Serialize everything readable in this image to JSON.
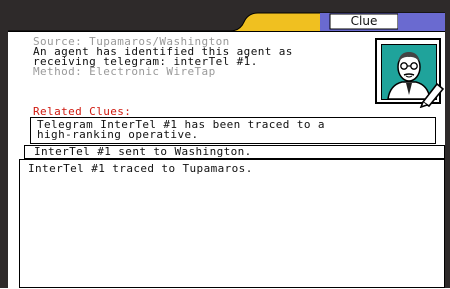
{
  "window": {
    "tab_title": "Clue"
  },
  "clue": {
    "source": "Source: Tupamaros/Washington",
    "description_line1": "An agent has identified this agent as",
    "description_line2": "receiving telegram: interTel #1.",
    "method": "Method: Electronic WireTap"
  },
  "related": {
    "heading": "Related Clues:",
    "items": [
      {
        "line1": "Telegram InterTel #1 has been traced to a",
        "line2": "high-ranking operative."
      },
      {
        "line1": "InterTel #1 sent to Washington."
      },
      {
        "line1": "InterTel #1 traced to Tupamaros."
      }
    ]
  },
  "colors": {
    "frame": "#2e2a2a",
    "tab": "#6a6ad0",
    "related_heading": "#d01a10",
    "portrait_bg": "#1fa39b"
  },
  "icons": {
    "portrait": "agent-portrait-icon",
    "pencil": "pencil-icon"
  }
}
